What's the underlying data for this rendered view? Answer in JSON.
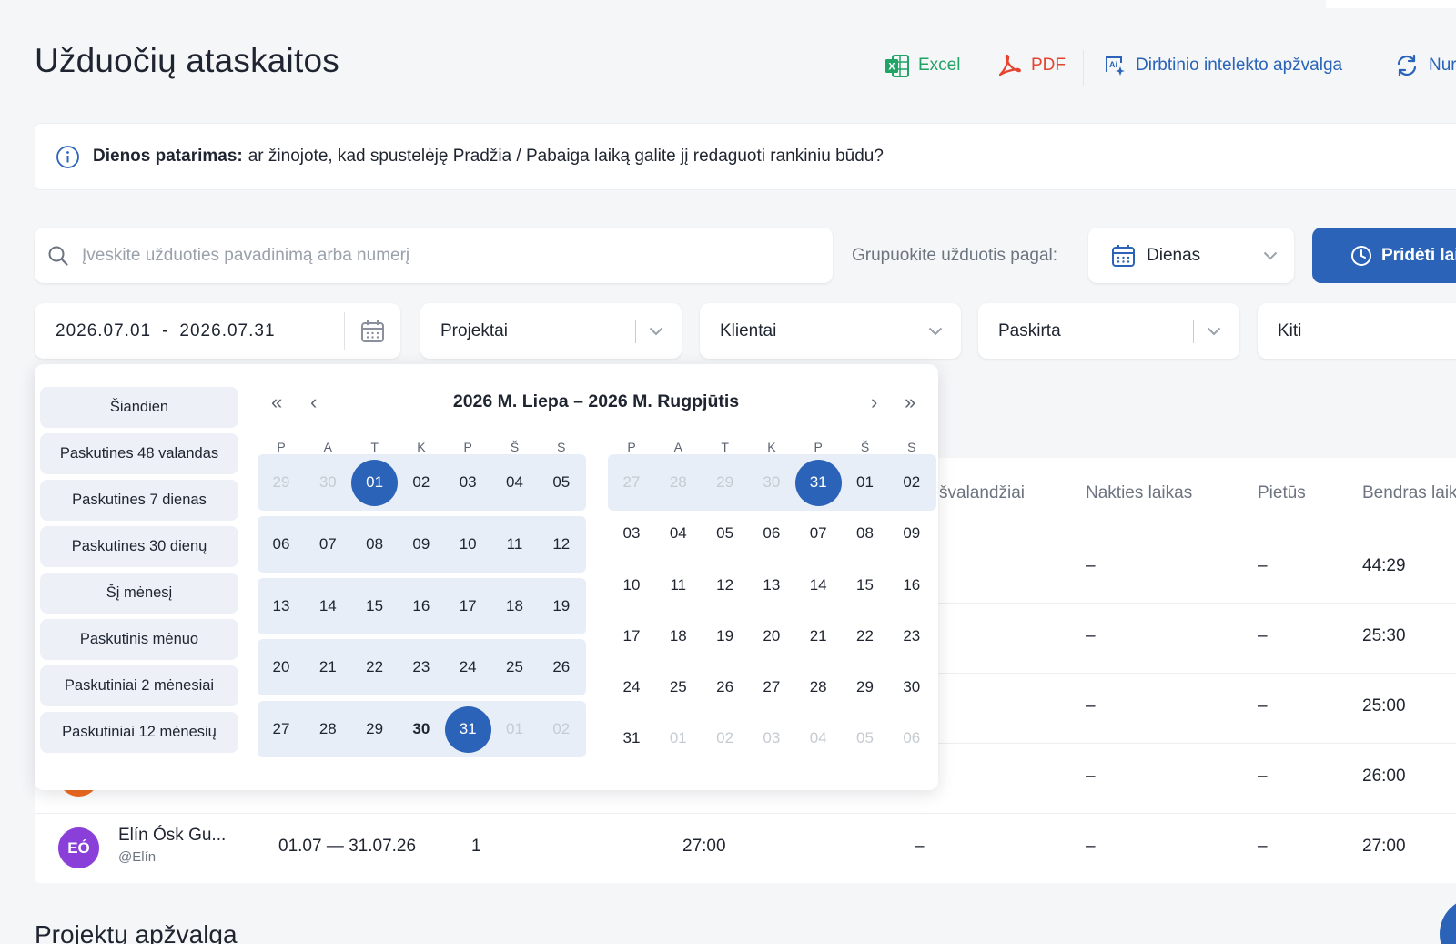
{
  "page": {
    "title": "Užduočių ataskaitos",
    "toolbar": {
      "excel": "Excel",
      "pdf": "PDF",
      "ai_review": "Dirbtinio intelekto apžvalga",
      "reset": "Nur"
    },
    "tip": {
      "label": "Dienos patarimas:",
      "text": "ar žinojote, kad spustelėję Pradžia / Pabaiga laiką galite jį redaguoti rankiniu būdu?"
    },
    "search": {
      "placeholder": "Įveskite užduoties pavadinimą arba numerį"
    },
    "group_by": {
      "label": "Grupuokite užduotis pagal:",
      "value": "Dienas"
    },
    "add_button": "Pridėti lai",
    "date_range": {
      "start": "2026.07.01",
      "separator": "-",
      "end": "2026.07.31"
    },
    "filters": {
      "projects": "Projektai",
      "clients": "Klientai",
      "assigned": "Paskirta",
      "other": "Kiti"
    },
    "section_title": "Projektų apžvalga"
  },
  "table": {
    "headers": {
      "overtime": "švalandžiai",
      "night": "Nakties laikas",
      "lunch": "Pietūs",
      "total": "Bendras laik"
    },
    "rows": [
      {
        "night": "–",
        "lunch": "–",
        "total": "44:29"
      },
      {
        "night": "–",
        "lunch": "–",
        "total": "25:30"
      },
      {
        "night": "–",
        "lunch": "–",
        "total": "25:00"
      },
      {
        "night": "–",
        "lunch": "–",
        "total": "26:00"
      }
    ],
    "last_row": {
      "initials": "EÓ",
      "avatar_color": "#8b3fd9",
      "name": "Elín Ósk Gu...",
      "username": "@Elín",
      "period": "01.07 — 31.07.26",
      "count": "1",
      "hours": "27:00",
      "overtime": "–",
      "night": "–",
      "lunch": "–",
      "total": "27:00"
    }
  },
  "datepicker": {
    "presets": [
      "Šiandien",
      "Paskutines 48 valandas",
      "Paskutines 7 dienas",
      "Paskutines 30 dienų",
      "Šį mėnesį",
      "Paskutinis mėnuo",
      "Paskutiniai 2 mėnesiai",
      "Paskutiniai 12 mėnesių"
    ],
    "title": "2026 M. Liepa – 2026 M. Rugpjūtis",
    "weekdays": [
      "P",
      "A",
      "T",
      "K",
      "P",
      "Š",
      "S"
    ],
    "left_month": [
      [
        "29",
        "30",
        "01",
        "02",
        "03",
        "04",
        "05"
      ],
      [
        "06",
        "07",
        "08",
        "09",
        "10",
        "11",
        "12"
      ],
      [
        "13",
        "14",
        "15",
        "16",
        "17",
        "18",
        "19"
      ],
      [
        "20",
        "21",
        "22",
        "23",
        "24",
        "25",
        "26"
      ],
      [
        "27",
        "28",
        "29",
        "30",
        "31",
        "01",
        "02"
      ]
    ],
    "right_month": [
      [
        "27",
        "28",
        "29",
        "30",
        "31",
        "01",
        "02"
      ],
      [
        "03",
        "04",
        "05",
        "06",
        "07",
        "08",
        "09"
      ],
      [
        "10",
        "11",
        "12",
        "13",
        "14",
        "15",
        "16"
      ],
      [
        "17",
        "18",
        "19",
        "20",
        "21",
        "22",
        "23"
      ],
      [
        "24",
        "25",
        "26",
        "27",
        "28",
        "29",
        "30"
      ],
      [
        "31",
        "01",
        "02",
        "03",
        "04",
        "05",
        "06"
      ]
    ],
    "accent": "#2a63b8",
    "range_bg": "#e8eef7"
  }
}
